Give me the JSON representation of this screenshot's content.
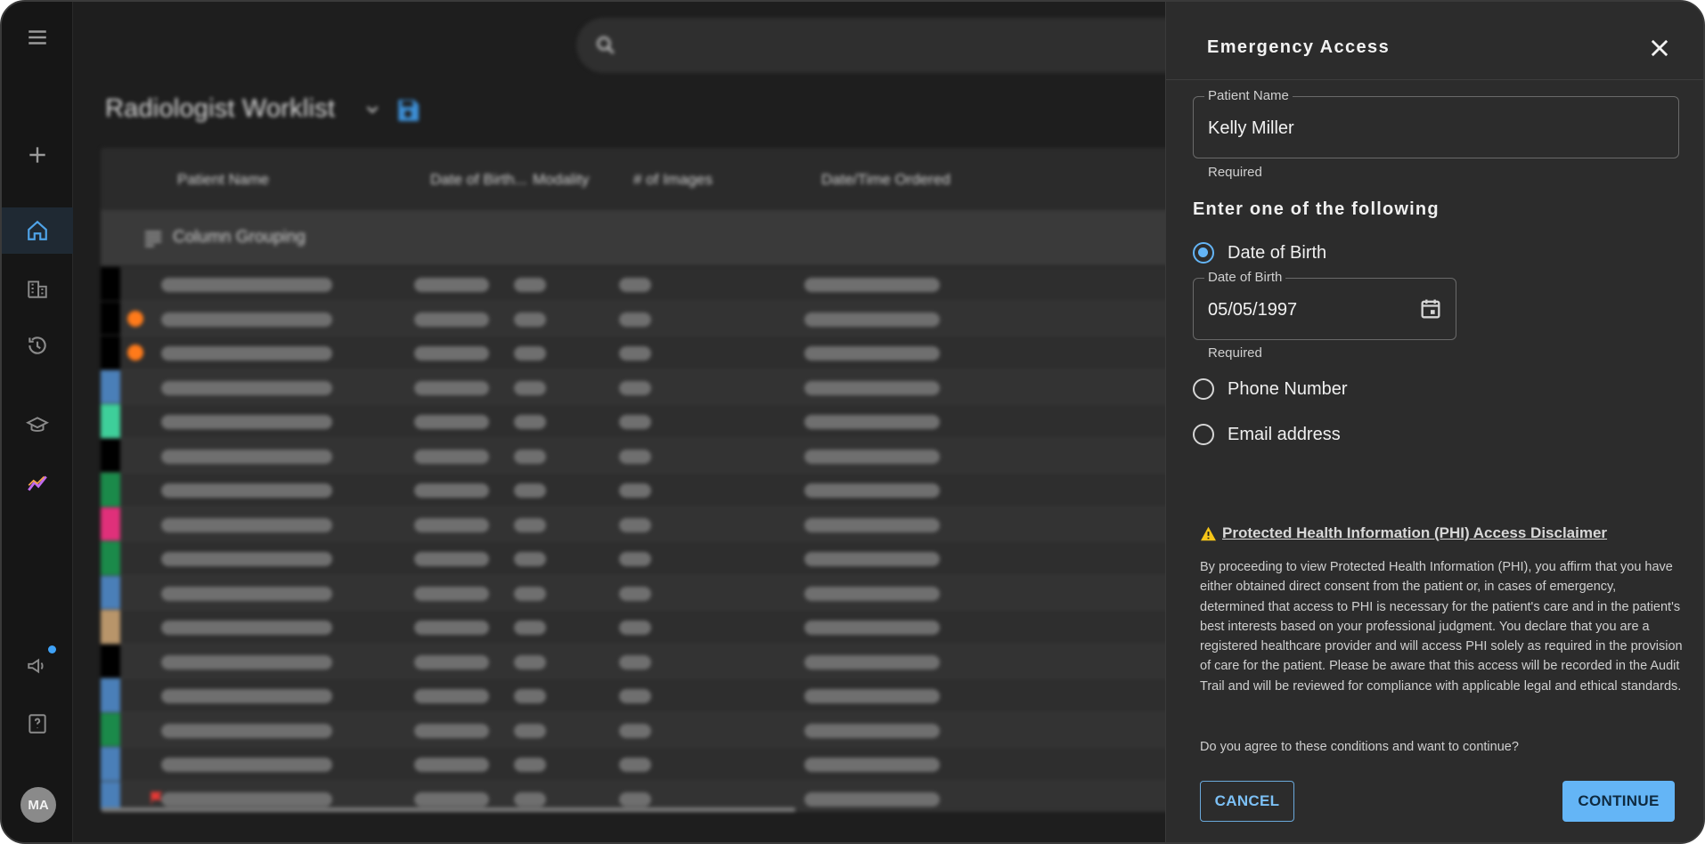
{
  "rail": {
    "avatar_initials": "MA",
    "items": [
      "menu-icon",
      "plus-icon",
      "home-icon",
      "building-icon",
      "history-icon",
      "school-icon",
      "analytics-icon",
      "megaphone-icon",
      "help-book-icon"
    ]
  },
  "worklist": {
    "title": "Radiologist Worklist",
    "columns": [
      "Patient Name",
      "Date of Birth...",
      "Modality",
      "# of Images",
      "Date/Time Ordered"
    ],
    "grouping_label": "Column Grouping",
    "row_tag_colors": [
      "#000000",
      "#000000",
      "#000000",
      "#4a7fb8",
      "#3ecf9a",
      "#000000",
      "#1b8a4a",
      "#e0307a",
      "#1b8a4a",
      "#4a7fb8",
      "#b8956a",
      "#000000",
      "#4a7fb8",
      "#1b8a4a",
      "#4a7fb8",
      "#4a7fb8"
    ]
  },
  "dialog": {
    "title": "Emergency Access",
    "patient_name": {
      "legend": "Patient Name",
      "value": "Kelly Miller",
      "helper": "Required"
    },
    "section_title": "Enter one of the following",
    "options": {
      "dob": "Date of Birth",
      "phone": "Phone Number",
      "email": "Email address"
    },
    "dob_field": {
      "legend": "Date of Birth",
      "value": "05/05/1997",
      "helper": "Required"
    },
    "disclaimer": {
      "title": "Protected Health Information (PHI) Access Disclaimer",
      "body": "By proceeding to view Protected Health Information (PHI), you affirm that you have either obtained direct consent from the patient or, in cases of emergency, determined that access to PHI is necessary for the patient's care and in the patient's best interests based on your professional judgment. You declare that you are a registered healthcare provider and will access PHI solely as required in the provision of care for the patient. Please be aware that this access will be recorded in the Audit Trail and will be reviewed for compliance with applicable legal and ethical standards.",
      "question": "Do you agree to these conditions and want to continue?"
    },
    "buttons": {
      "cancel": "CANCEL",
      "continue": "CONTINUE"
    },
    "accent_color": "#64b5f6"
  }
}
